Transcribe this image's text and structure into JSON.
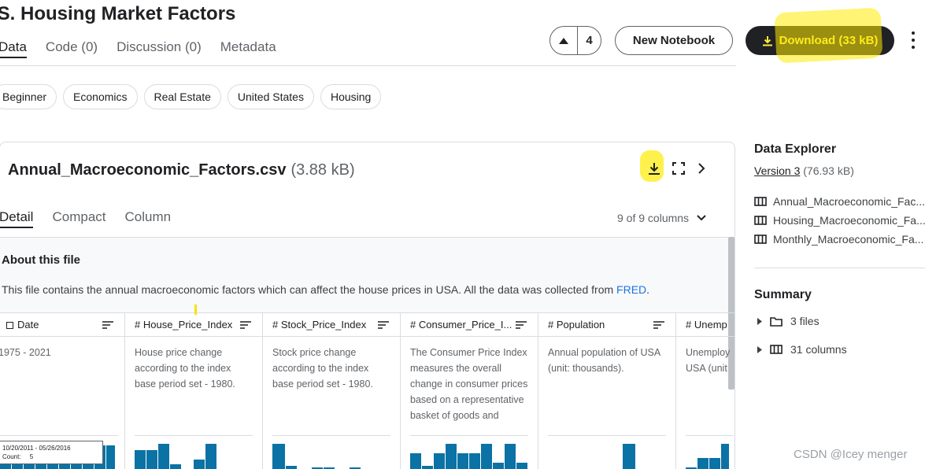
{
  "header": {
    "title": ".S. Housing Market Factors",
    "tabs": [
      {
        "label": "Data"
      },
      {
        "label": "Code (0)"
      },
      {
        "label": "Discussion (0)"
      },
      {
        "label": "Metadata"
      }
    ],
    "vote_count": "4",
    "new_notebook_label": "New Notebook",
    "download_label": "Download (33 kB)"
  },
  "tags": [
    "Beginner",
    "Economics",
    "Real Estate",
    "United States",
    "Housing"
  ],
  "file": {
    "name": "Annual_Macroeconomic_Factors.csv",
    "size": "(3.88 kB)",
    "view_tabs": [
      {
        "label": "Detail"
      },
      {
        "label": "Compact"
      },
      {
        "label": "Column"
      }
    ],
    "column_count": "9 of 9 columns",
    "about_title": "About this file",
    "about_desc": "This file contains the annual macroeconomic factors which can affect the house prices in USA. All the data was collected from ",
    "about_link": "FRED",
    "about_end": ".",
    "columns": [
      {
        "type_icon": "calendar-icon",
        "name": "Date",
        "desc": "1975 - 2021"
      },
      {
        "type_icon": "hash-icon",
        "name": "# House_Price_Index",
        "desc": "House price change according to the index base period set - 1980."
      },
      {
        "type_icon": "hash-icon",
        "name": "# Stock_Price_Index",
        "desc": "Stock price change according to the index base period set - 1980."
      },
      {
        "type_icon": "hash-icon",
        "name": "# Consumer_Price_I...",
        "desc": "The Consumer Price Index measures the overall change in consumer prices based on a representative basket of goods and"
      },
      {
        "type_icon": "hash-icon",
        "name": "# Population",
        "desc": "Annual population of USA (unit: thousands)."
      },
      {
        "type_icon": "hash-icon",
        "name": "# Unemp",
        "desc": "Unemploy USA (unit"
      }
    ],
    "tooltip_range": "10/20/2011 - 05/26/2016",
    "tooltip_count_label": "Count:",
    "tooltip_count_value": "5"
  },
  "sidebar": {
    "explorer_title": "Data Explorer",
    "version_link": "Version 3",
    "version_size": "(76.93 kB)",
    "files": [
      "Annual_Macroeconomic_Fac...",
      "Housing_Macroeconomic_Fa...",
      "Monthly_Macroeconomic_Fa..."
    ],
    "summary_title": "Summary",
    "summary_items": [
      "3 files",
      "31 columns"
    ]
  },
  "watermark": "CSDN @Icey menger",
  "colors": {
    "accent": "#0a72a4",
    "highlight": "#ffeb00",
    "dark_button": "#202124"
  }
}
